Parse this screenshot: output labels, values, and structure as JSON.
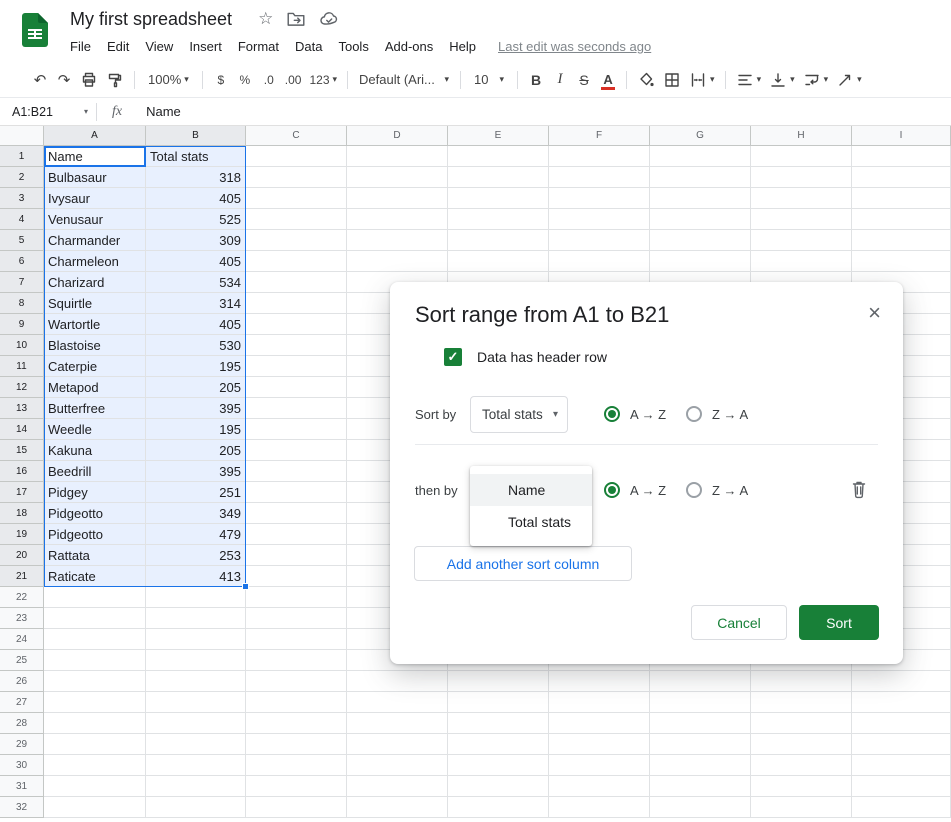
{
  "header": {
    "title": "My first spreadsheet",
    "menu_items": [
      "File",
      "Edit",
      "View",
      "Insert",
      "Format",
      "Data",
      "Tools",
      "Add-ons",
      "Help"
    ],
    "last_edit": "Last edit was seconds ago"
  },
  "toolbar": {
    "zoom": "100%",
    "currency": "$",
    "percent": "%",
    "decimal_decrease": ".0",
    "decimal_increase": ".00",
    "more_formats": "123",
    "font_family": "Default (Ari...",
    "font_size": "10",
    "bold": "B",
    "italic": "I",
    "strikethrough": "S",
    "text_color": "A"
  },
  "formula_bar": {
    "name_box": "A1:B21",
    "fx_label": "fx",
    "value": "Name"
  },
  "grid": {
    "column_headers": [
      "A",
      "B",
      "C",
      "D",
      "E",
      "F",
      "G",
      "H",
      "I"
    ],
    "row_count": 32,
    "selection": {
      "range": "A1:B21",
      "active_cell": "A1"
    },
    "table": {
      "headers": [
        "Name",
        "Total stats"
      ],
      "rows": [
        [
          "Bulbasaur",
          "318"
        ],
        [
          "Ivysaur",
          "405"
        ],
        [
          "Venusaur",
          "525"
        ],
        [
          "Charmander",
          "309"
        ],
        [
          "Charmeleon",
          "405"
        ],
        [
          "Charizard",
          "534"
        ],
        [
          "Squirtle",
          "314"
        ],
        [
          "Wartortle",
          "405"
        ],
        [
          "Blastoise",
          "530"
        ],
        [
          "Caterpie",
          "195"
        ],
        [
          "Metapod",
          "205"
        ],
        [
          "Butterfree",
          "395"
        ],
        [
          "Weedle",
          "195"
        ],
        [
          "Kakuna",
          "205"
        ],
        [
          "Beedrill",
          "395"
        ],
        [
          "Pidgey",
          "251"
        ],
        [
          "Pidgeotto",
          "349"
        ],
        [
          "Pidgeotto",
          "479"
        ],
        [
          "Rattata",
          "253"
        ],
        [
          "Raticate",
          "413"
        ]
      ]
    }
  },
  "dialog": {
    "title": "Sort range from A1 to B21",
    "header_row_label": "Data has header row",
    "sort_by_label": "Sort by",
    "sort_by_value": "Total stats",
    "then_by_label": "then by",
    "asc_label": "A → Z",
    "desc_label": "Z → A",
    "dropdown_items": [
      "Name",
      "Total stats"
    ],
    "add_column_label": "Add another sort column",
    "cancel_label": "Cancel",
    "sort_label": "Sort"
  },
  "icons": {
    "undo": "↶",
    "redo": "↷",
    "star": "☆",
    "caret": "▾",
    "close": "×",
    "check": "✓"
  },
  "colors": {
    "brand_green": "#188038",
    "accent_blue": "#1a73e8",
    "selection_fill": "#e8f0fe",
    "selection_border": "#1a73e8",
    "text_color_bar": "#d93025"
  }
}
